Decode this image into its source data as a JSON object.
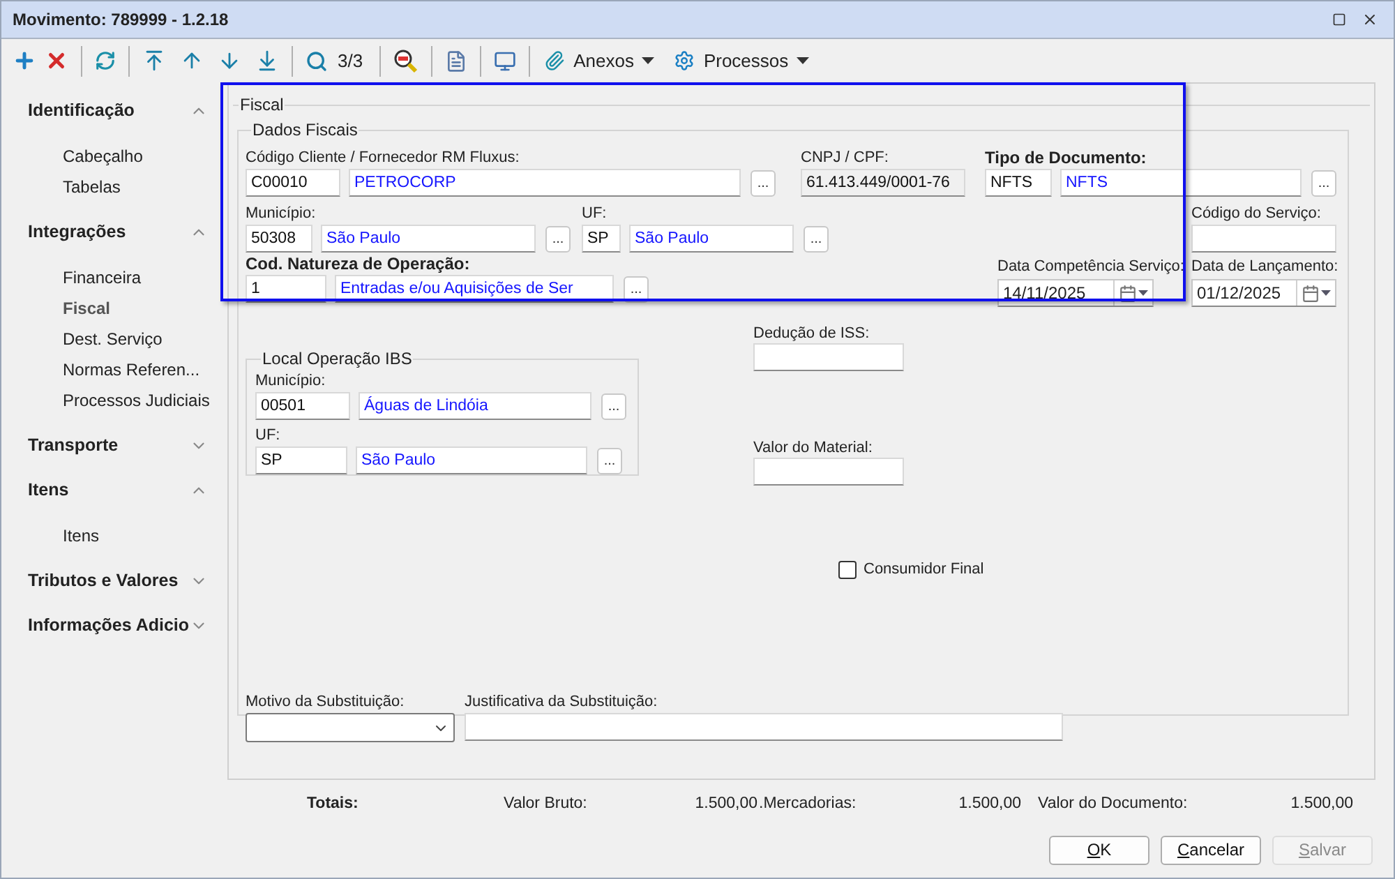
{
  "window": {
    "title": "Movimento: 789999 - 1.2.18"
  },
  "toolbar": {
    "record_counter": "3/3",
    "menus": [
      {
        "label": "Anexos"
      },
      {
        "label": "Processos"
      }
    ]
  },
  "sidebar": {
    "sections": [
      {
        "label": "Identificação",
        "expanded": true,
        "items": [
          {
            "label": "Cabeçalho",
            "selected": false
          },
          {
            "label": "Tabelas",
            "selected": false
          }
        ]
      },
      {
        "label": "Integrações",
        "expanded": true,
        "items": [
          {
            "label": "Financeira",
            "selected": false
          },
          {
            "label": "Fiscal",
            "selected": true
          },
          {
            "label": "Dest. Serviço",
            "selected": false
          },
          {
            "label": "Normas Referen...",
            "selected": false
          },
          {
            "label": "Processos Judiciais",
            "selected": false
          }
        ]
      },
      {
        "label": "Transporte",
        "expanded": false
      },
      {
        "label": "Itens",
        "expanded": true,
        "items": [
          {
            "label": "Itens",
            "selected": false
          }
        ]
      },
      {
        "label": "Tributos e Valores",
        "expanded": false
      },
      {
        "label": "Informações Adicio",
        "expanded": false
      }
    ]
  },
  "fiscal": {
    "title": "Fiscal",
    "dados_fiscais": {
      "title": "Dados Fiscais",
      "cliente": {
        "label": "Código Cliente / Fornecedor RM Fluxus:",
        "required": false,
        "code": "C00010",
        "name": "PETROCORP",
        "button": "..."
      },
      "cnpj": {
        "label": "CNPJ / CPF:",
        "value": "61.413.449/0001-76",
        "disabled": true
      },
      "tipo_documento": {
        "label": "Tipo de Documento:",
        "required": true,
        "code": "NFTS",
        "name": "NFTS",
        "button": "..."
      },
      "municipio": {
        "label": "Município:",
        "required": false,
        "code": "50308",
        "name": "São Paulo",
        "button": "..."
      },
      "uf": {
        "label": "UF:",
        "required": false,
        "code": "SP",
        "name": "São Paulo",
        "button": "..."
      },
      "codigo_servico": {
        "label": "Código do Serviço:"
      },
      "natureza_operacao": {
        "label": "Cod. Natureza de Operação:",
        "required": true,
        "code": "1",
        "name": "Entradas e/ou Aquisições de Ser",
        "button": "..."
      },
      "data_competencia": {
        "label": "Data Competência Serviço:",
        "value": "14/11/2025"
      },
      "data_lancamento": {
        "label": "Data de Lançamento:",
        "value": "01/12/2025"
      },
      "deducao_iss": {
        "label": "Dedução de ISS:"
      },
      "local_operacao_ibs": {
        "title": "Local Operação IBS",
        "municipio": {
          "label": "Município:",
          "required": false,
          "code": "00501",
          "name": "Águas de Lindóia",
          "button": "..."
        },
        "uf": {
          "label": "UF:",
          "required": false,
          "code": "SP",
          "name": "São Paulo",
          "button": "..."
        }
      },
      "valor_material": {
        "label": "Valor do Material:"
      },
      "consumidor_final": {
        "label": "Consumidor Final",
        "checked": false
      },
      "motivo_substituicao": {
        "label": "Motivo da Substituição:"
      },
      "justificativa_substituicao": {
        "label": "Justificativa da Substituição:"
      }
    }
  },
  "totals": {
    "label": "Totais:",
    "items": [
      {
        "label": "Valor Bruto:",
        "value": "1.500,00"
      },
      {
        "label": ".Mercadorias:",
        "value": "1.500,00"
      },
      {
        "label": "Valor do Documento:",
        "value": "1.500,00"
      }
    ]
  },
  "buttons": [
    {
      "label": "OK",
      "disabled": false
    },
    {
      "label": "Cancelar",
      "disabled": false
    },
    {
      "label": "Salvar",
      "disabled": true
    }
  ]
}
